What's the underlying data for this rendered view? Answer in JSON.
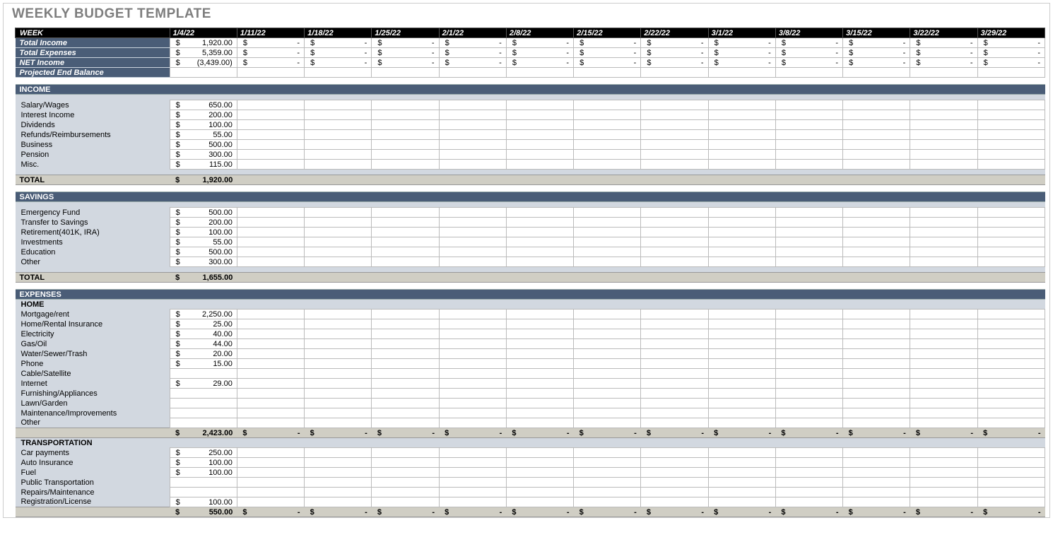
{
  "title": "WEEKLY BUDGET TEMPLATE",
  "weeks": [
    "1/4/22",
    "1/11/22",
    "1/18/22",
    "1/25/22",
    "2/1/22",
    "2/8/22",
    "2/15/22",
    "2/22/22",
    "3/1/22",
    "3/8/22",
    "3/15/22",
    "3/22/22",
    "3/29/22"
  ],
  "summary": {
    "rows": [
      {
        "label": "Total Income",
        "values": [
          "1,920.00",
          "-",
          "-",
          "-",
          "-",
          "-",
          "-",
          "-",
          "-",
          "-",
          "-",
          "-",
          "-"
        ]
      },
      {
        "label": "Total Expenses",
        "values": [
          "5,359.00",
          "-",
          "-",
          "-",
          "-",
          "-",
          "-",
          "-",
          "-",
          "-",
          "-",
          "-",
          "-"
        ]
      },
      {
        "label": "NET Income",
        "values": [
          "(3,439.00)",
          "-",
          "-",
          "-",
          "-",
          "-",
          "-",
          "-",
          "-",
          "-",
          "-",
          "-",
          "-"
        ]
      },
      {
        "label": "Projected End Balance",
        "values": [
          "",
          "",
          "",
          "",
          "",
          "",
          "",
          "",
          "",
          "",
          "",
          "",
          ""
        ]
      }
    ]
  },
  "income": {
    "header": "INCOME",
    "rows": [
      {
        "label": "Salary/Wages",
        "v": "650.00"
      },
      {
        "label": "Interest Income",
        "v": "200.00"
      },
      {
        "label": "Dividends",
        "v": "100.00"
      },
      {
        "label": "Refunds/Reimbursements",
        "v": "55.00"
      },
      {
        "label": "Business",
        "v": "500.00"
      },
      {
        "label": "Pension",
        "v": "300.00"
      },
      {
        "label": "Misc.",
        "v": "115.00"
      }
    ],
    "total_label": "TOTAL",
    "total": "1,920.00"
  },
  "savings": {
    "header": "SAVINGS",
    "rows": [
      {
        "label": "Emergency Fund",
        "v": "500.00"
      },
      {
        "label": "Transfer to Savings",
        "v": "200.00"
      },
      {
        "label": "Retirement(401K, IRA)",
        "v": "100.00"
      },
      {
        "label": "Investments",
        "v": "55.00"
      },
      {
        "label": "Education",
        "v": "500.00"
      },
      {
        "label": "Other",
        "v": "300.00"
      }
    ],
    "total_label": "TOTAL",
    "total": "1,655.00"
  },
  "expenses": {
    "header": "EXPENSES",
    "groups": [
      {
        "sub": "HOME",
        "rows": [
          {
            "label": "Mortgage/rent",
            "v": "2,250.00"
          },
          {
            "label": "Home/Rental Insurance",
            "v": "25.00"
          },
          {
            "label": "Electricity",
            "v": "40.00"
          },
          {
            "label": "Gas/Oil",
            "v": "44.00"
          },
          {
            "label": "Water/Sewer/Trash",
            "v": "20.00"
          },
          {
            "label": "Phone",
            "v": "15.00"
          },
          {
            "label": "Cable/Satellite",
            "v": ""
          },
          {
            "label": "Internet",
            "v": "29.00"
          },
          {
            "label": "Furnishing/Appliances",
            "v": ""
          },
          {
            "label": "Lawn/Garden",
            "v": ""
          },
          {
            "label": "Maintenance/Improvements",
            "v": ""
          },
          {
            "label": "Other",
            "v": ""
          }
        ],
        "subtotal": "2,423.00",
        "subtotals_rest": [
          "-",
          "-",
          "-",
          "-",
          "-",
          "-",
          "-",
          "-",
          "-",
          "-",
          "-",
          "-"
        ]
      },
      {
        "sub": "TRANSPORTATION",
        "rows": [
          {
            "label": "Car payments",
            "v": "250.00"
          },
          {
            "label": "Auto Insurance",
            "v": "100.00"
          },
          {
            "label": "Fuel",
            "v": "100.00"
          },
          {
            "label": "Public Transportation",
            "v": ""
          },
          {
            "label": "Repairs/Maintenance",
            "v": ""
          },
          {
            "label": "Registration/License",
            "v": "100.00"
          }
        ],
        "subtotal": "550.00",
        "subtotals_rest": [
          "-",
          "-",
          "-",
          "-",
          "-",
          "-",
          "-",
          "-",
          "-",
          "-",
          "-",
          "-"
        ]
      }
    ]
  }
}
